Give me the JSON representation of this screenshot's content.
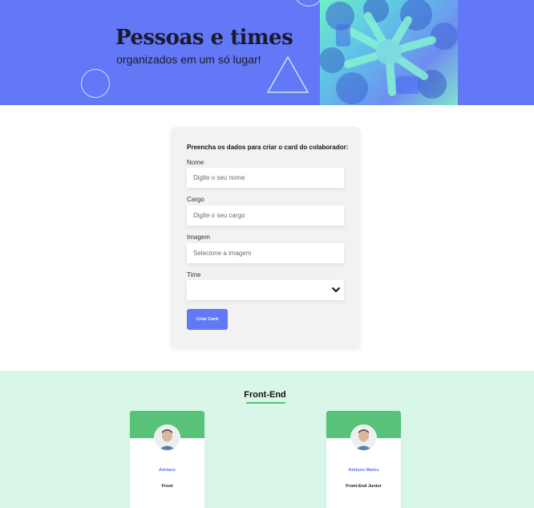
{
  "banner": {
    "title": "Pessoas e times",
    "subtitle": "organizados em um só lugar!"
  },
  "form": {
    "heading": "Preencha os dados para criar o card do colaborador:",
    "fields": [
      {
        "label": "Nome",
        "placeholder": "Digite o seu nome"
      },
      {
        "label": "Cargo",
        "placeholder": "Digite o seu cargo"
      },
      {
        "label": "Imagem",
        "placeholder": "Selecione a imagem"
      },
      {
        "label": "Time",
        "selected": ""
      }
    ],
    "submit_label": "Criar Card"
  },
  "team": {
    "name": "Front-End",
    "accent_color": "#57c278",
    "background_color": "#d9f7e9",
    "members": [
      {
        "name": "Adriano",
        "role": "Front"
      },
      {
        "name": "Adriano Matos",
        "role": "Front-End Junior"
      }
    ]
  },
  "colors": {
    "primary": "#6278f7"
  }
}
